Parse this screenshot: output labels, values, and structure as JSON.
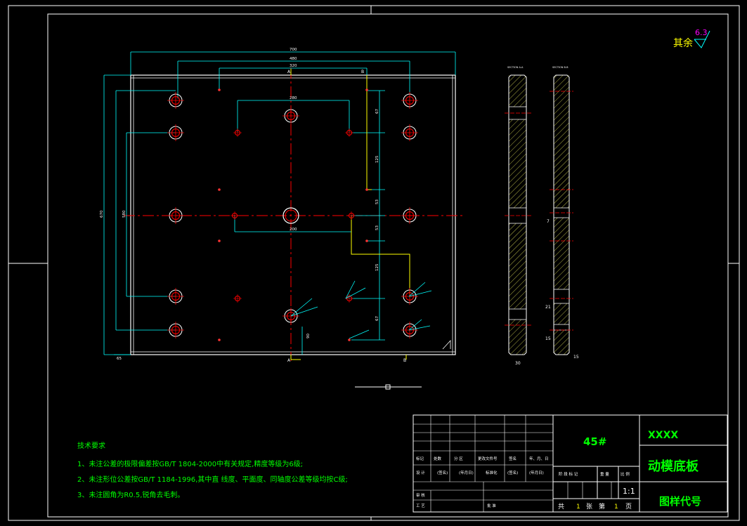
{
  "surface_finish": {
    "prefix": "其余",
    "value": "6.3"
  },
  "dimensions": {
    "overall_width": "700",
    "width_2": "480",
    "width_3": "320",
    "inner_280": "280",
    "inner_200": "200",
    "height_670": "670",
    "height_580": "580",
    "edge_offset": "65",
    "v_67a": "67",
    "v_125a": "125",
    "v_53a": "53",
    "v_53b": "53",
    "v_125b": "125",
    "v_67b": "67",
    "bottom_90": "90",
    "section_thickness": "30",
    "section_2_dims": [
      "7",
      "21",
      "15",
      "15"
    ]
  },
  "section_labels": {
    "a": "SECTION A-A",
    "b": "SECTION B-B",
    "cut_mark": "A",
    "cut_mark_b": "B"
  },
  "notes": {
    "title": "技术要求",
    "items": [
      "1、未注公差的极限偏差按GB/T 1804-2000中有关规定,精度等级为6级;",
      "2、未注形位公差按GB/T 1184-1996,其中直 线度、平面度、同轴度公差等级均按C级;",
      "3、未注圆角为R0.5,锐角去毛刺。"
    ]
  },
  "title_block": {
    "row_labels": [
      "标记",
      "处数",
      "分 区",
      "更改文件号",
      "签名",
      "年、月、日"
    ],
    "design_row": [
      "设 计",
      "(签名)",
      "(年月日)",
      "标准化",
      "(签名)",
      "(年月日)"
    ],
    "stage_labels": [
      "阶 段 标 记",
      "重 量",
      "比 例"
    ],
    "review": "审 核",
    "process": "工 艺",
    "approve": "批 准",
    "material": "45#",
    "company": "XXXX",
    "part_name": "动模底板",
    "drawing_no": "图样代号",
    "scale": "1:1",
    "sheets_total_label": "共",
    "sheets_total": "1",
    "sheets_unit": "张",
    "sheet_label": "第",
    "sheet_no": "1",
    "sheet_unit": "页"
  }
}
